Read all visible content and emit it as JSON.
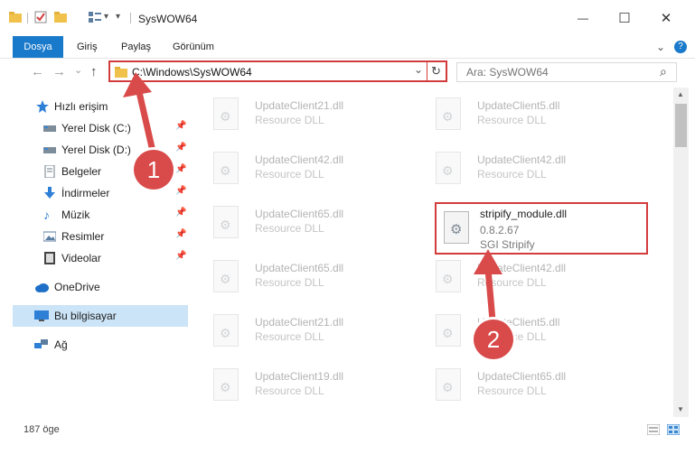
{
  "window": {
    "title": "SysWOW64",
    "minimize_glyph": "—",
    "maximize_glyph": "☐",
    "close_glyph": "✕",
    "dropdown_glyph": "▾"
  },
  "ribbon": {
    "tabs": [
      "Dosya",
      "Giriş",
      "Paylaş",
      "Görünüm"
    ],
    "chevron_glyph": "⌄",
    "help_glyph": "?"
  },
  "nav": {
    "back_glyph": "←",
    "forward_glyph": "→",
    "recent_glyph": "⌄",
    "up_glyph": "↑",
    "address": "C:\\Windows\\SysWOW64",
    "address_dropdown_glyph": "⌄",
    "refresh_glyph": "↻",
    "search_placeholder": "Ara: SysWOW64",
    "search_glyph": "⌕"
  },
  "sidebar": {
    "items": [
      {
        "label": "Hızlı erişim",
        "icon": "star-icon",
        "color": "#2e7fd6",
        "pinned": false
      },
      {
        "label": "Yerel Disk (C:)",
        "icon": "drive-icon",
        "color": "#5b7da0",
        "pinned": true
      },
      {
        "label": "Yerel Disk (D:)",
        "icon": "drive-icon",
        "color": "#5b7da0",
        "pinned": true
      },
      {
        "label": "Belgeler",
        "icon": "documents-icon",
        "color": "#8a9aa8",
        "pinned": true
      },
      {
        "label": "İndirmeler",
        "icon": "downloads-icon",
        "color": "#2e7fd6",
        "pinned": true
      },
      {
        "label": "Müzik",
        "icon": "music-icon",
        "color": "#2e7fd6",
        "pinned": true
      },
      {
        "label": "Resimler",
        "icon": "pictures-icon",
        "color": "#5b7da0",
        "pinned": true
      },
      {
        "label": "Videolar",
        "icon": "videos-icon",
        "color": "#444444",
        "pinned": true
      },
      {
        "label": "OneDrive",
        "icon": "cloud-icon",
        "color": "#1e6fc8",
        "pinned": false
      },
      {
        "label": "Bu bilgisayar",
        "icon": "computer-icon",
        "color": "#2e7fd6",
        "pinned": false,
        "selected": true
      },
      {
        "label": "Ağ",
        "icon": "network-icon",
        "color": "#2e7fd6",
        "pinned": false
      }
    ],
    "pin_glyph": "📌"
  },
  "files": {
    "left_column": [
      {
        "name": "UpdateClient21.dll",
        "desc": "Resource DLL"
      },
      {
        "name": "UpdateClient42.dll",
        "desc": "Resource DLL"
      },
      {
        "name": "UpdateClient65.dll",
        "desc": "Resource DLL"
      },
      {
        "name": "UpdateClient65.dll",
        "desc": "Resource DLL"
      },
      {
        "name": "UpdateClient21.dll",
        "desc": "Resource DLL"
      },
      {
        "name": "UpdateClient19.dll",
        "desc": "Resource DLL"
      }
    ],
    "right_column": [
      {
        "name": "UpdateClient5.dll",
        "desc": "Resource DLL"
      },
      {
        "name": "UpdateClient42.dll",
        "desc": "Resource DLL"
      },
      {
        "name": "UpdateClient42.dll",
        "desc": "Resource DLL"
      },
      {
        "name": "UpdateClient5.dll",
        "desc": "Resource DLL"
      },
      {
        "name": "UpdateClient65.dll",
        "desc": "Resource DLL"
      }
    ],
    "highlighted": {
      "name": "stripify_module.dll",
      "version": "0.8.2.67",
      "company": "SGI Stripify"
    },
    "gear_glyph": "⚙"
  },
  "status": {
    "count": "187 öge"
  },
  "callouts": [
    "1",
    "2"
  ],
  "colors": {
    "accent": "#1979ca",
    "highlight_border": "#d33c3c",
    "callout": "#d94a4a",
    "selected_row": "#cce4f7"
  }
}
